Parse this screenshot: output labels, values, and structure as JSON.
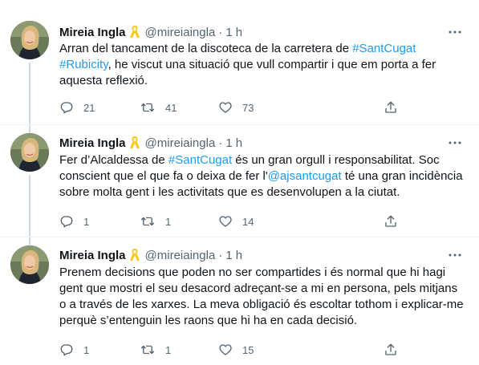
{
  "author": {
    "name": "Mireia Ingla",
    "handle": "@mireiaingla",
    "badge_icon": "yellow-ribbon-icon"
  },
  "colors": {
    "link": "#1d9bf0",
    "secondary_text": "#536471",
    "ribbon": "#f7c81e"
  },
  "tweets": [
    {
      "time": "1 h",
      "lines": [
        [
          {
            "t": "Arran del tancament de la discoteca de la carretera de "
          },
          {
            "t": "#SantCugat",
            "link": true
          }
        ],
        [
          {
            "t": "#Rubicity",
            "link": true
          },
          {
            "t": ", he viscut una situació que vull compartir i que em porta a fer"
          }
        ],
        [
          {
            "t": "aquesta reflexió."
          }
        ]
      ],
      "replies": "21",
      "retweets": "41",
      "likes": "73"
    },
    {
      "time": "1 h",
      "lines": [
        [
          {
            "t": "Fer d’Alcaldessa de "
          },
          {
            "t": "#SantCugat",
            "link": true
          },
          {
            "t": " és un gran orgull i responsabilitat. Soc"
          }
        ],
        [
          {
            "t": "conscient que el que fa o deixa de fer l'"
          },
          {
            "t": "@ajsantcugat",
            "link": true
          },
          {
            "t": " té una gran incidència"
          }
        ],
        [
          {
            "t": "sobre molta gent i les activitats que es desenvolupen a la ciutat."
          }
        ]
      ],
      "replies": "1",
      "retweets": "1",
      "likes": "14"
    },
    {
      "time": "1 h",
      "lines": [
        [
          {
            "t": "Prenem decisions que poden no ser compartides i és normal que hi hagi"
          }
        ],
        [
          {
            "t": "gent que mostri el seu desacord adreçant-se a mi en persona, pels mitjans"
          }
        ],
        [
          {
            "t": "o a través de les xarxes. La meva obligació és escoltar tothom i explicar-me"
          }
        ],
        [
          {
            "t": "perquè s’entenguin les raons que hi ha en cada decisió."
          }
        ]
      ],
      "replies": "1",
      "retweets": "1",
      "likes": "15"
    }
  ],
  "ui": {
    "dot": "·",
    "more_icon": "more-horizontal-icon",
    "reply_icon": "reply-bubble-icon",
    "retweet_icon": "retweet-icon",
    "like_icon": "heart-icon",
    "share_icon": "share-upload-icon"
  }
}
